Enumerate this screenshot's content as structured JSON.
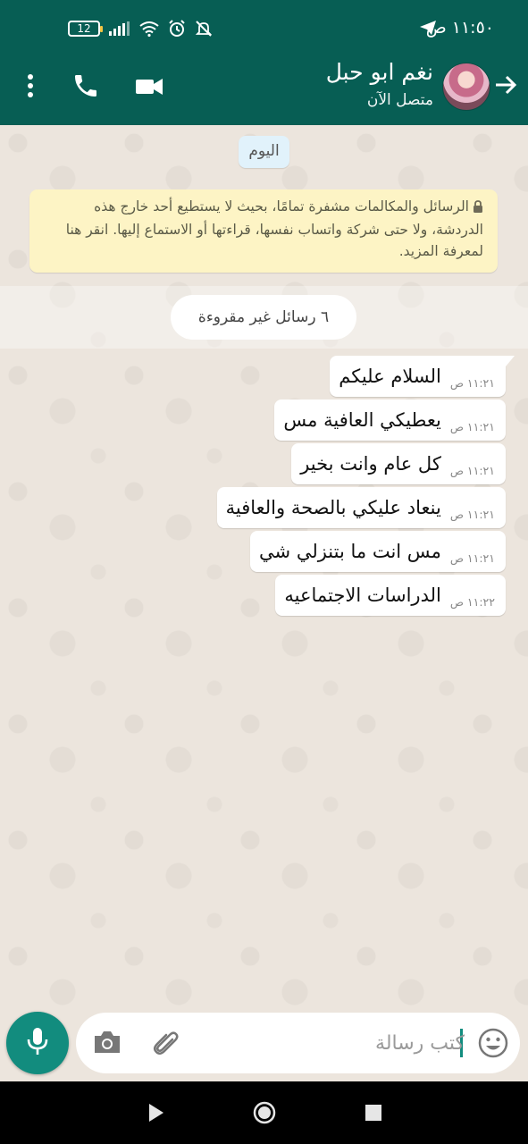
{
  "status_bar": {
    "time": "١١:٥٠ ص",
    "battery": "12"
  },
  "header": {
    "contact_name": "نغم ابو حبل",
    "contact_status": "متصل الآن"
  },
  "chat": {
    "date_chip": "اليوم",
    "encryption_notice": "الرسائل والمكالمات مشفرة تمامًا، بحيث لا يستطيع أحد خارج هذه الدردشة، ولا حتى شركة واتساب نفسها، قراءتها أو الاستماع إليها. انقر هنا لمعرفة المزيد.",
    "unread_label": "٦ رسائل غير مقروءة",
    "messages": [
      {
        "text": "السلام عليكم",
        "time": "١١:٢١ ص"
      },
      {
        "text": "يعطيكي العافية مس",
        "time": "١١:٢١ ص"
      },
      {
        "text": "كل عام وانت بخير",
        "time": "١١:٢١ ص"
      },
      {
        "text": "ينعاد عليكي بالصحة والعافية",
        "time": "١١:٢١ ص"
      },
      {
        "text": "مس انت ما بتنزلي شي",
        "time": "١١:٢١ ص"
      },
      {
        "text": "الدراسات الاجتماعيه",
        "time": "١١:٢٢ ص"
      }
    ]
  },
  "composer": {
    "placeholder": "كتب رسالة"
  },
  "colors": {
    "header": "#075e54",
    "accent": "#128c7e",
    "chat_bg": "#ece5dd",
    "notice_bg": "#fdf4c5"
  }
}
